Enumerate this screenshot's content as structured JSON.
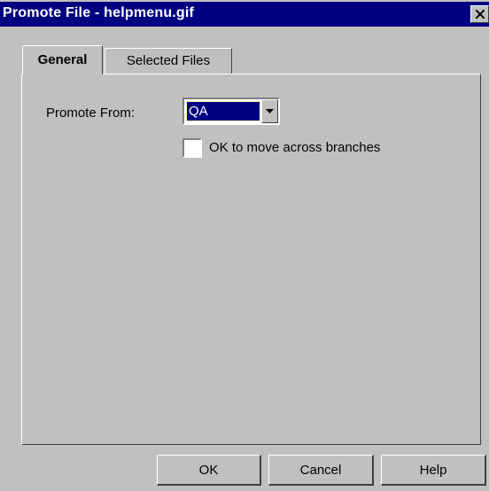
{
  "window": {
    "title": "Promote File - helpmenu.gif"
  },
  "tabs": [
    {
      "label": "General",
      "active": true
    },
    {
      "label": "Selected Files",
      "active": false
    }
  ],
  "form": {
    "promote_from_label": "Promote From:",
    "promote_from_value": "QA",
    "move_across_label": "OK to move across branches",
    "move_across_checked": false
  },
  "buttons": {
    "ok": "OK",
    "cancel": "Cancel",
    "help": "Help"
  },
  "icons": {
    "close": "close-icon",
    "dropdown": "chevron-down-icon"
  },
  "colors": {
    "titlebar": "#000080",
    "face": "#c0c0c0",
    "selection": "#000080"
  }
}
